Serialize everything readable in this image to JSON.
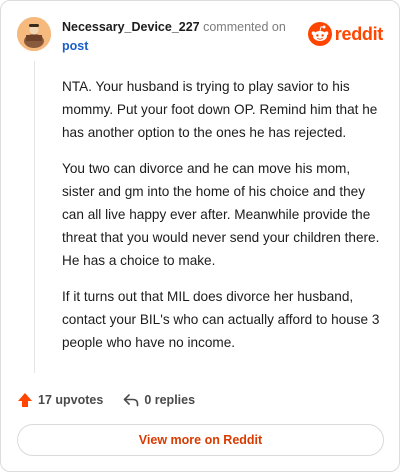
{
  "header": {
    "username": "Necessary_Device_227",
    "commented_text": "commented on",
    "post_link": "post",
    "brand_word": "reddit"
  },
  "comment": {
    "paragraphs": [
      "NTA. Your husband is trying to play savior to his mommy. Put your foot down OP. Remind him that he has another option to the ones he has rejected.",
      "You two can divorce and he can move his mom, sister and gm into the home of his choice and they can all live happy ever after. Meanwhile provide the threat that you would never send your children there. He has a choice to make.",
      "If it turns out that MIL does divorce her husband, contact your BIL's who can actually afford to house 3 people who have no income."
    ]
  },
  "actions": {
    "upvotes": "17 upvotes",
    "replies": "0 replies"
  },
  "button": {
    "label": "View more on Reddit"
  },
  "colors": {
    "brand": "#ff4500",
    "link": "#1a5fc8",
    "button_text": "#d93a00"
  },
  "icons": [
    "avatar",
    "reddit-logo-icon",
    "upvote-arrow-icon",
    "reply-arrow-icon"
  ]
}
